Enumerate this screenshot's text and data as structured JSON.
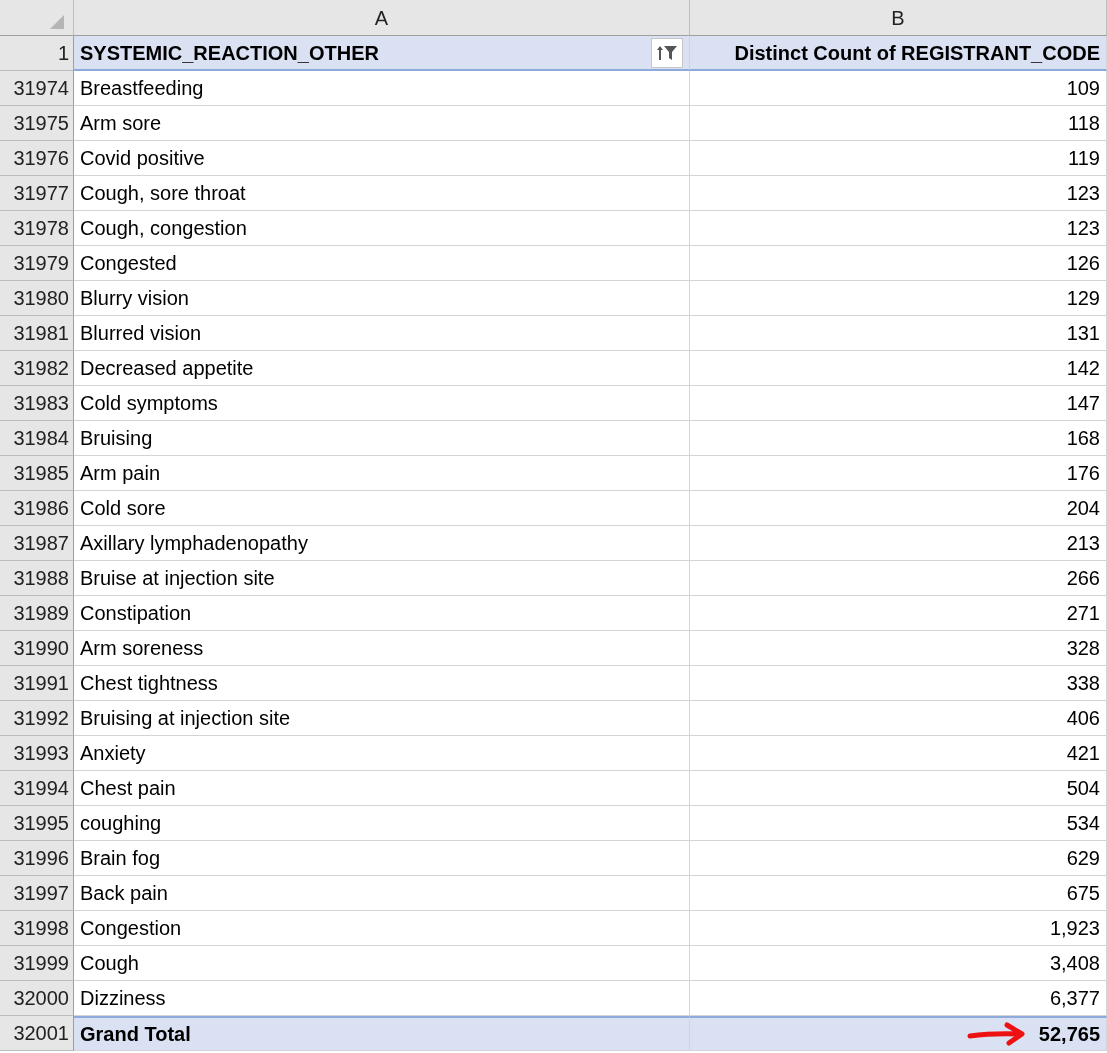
{
  "column_headers": [
    "A",
    "B"
  ],
  "header_row": {
    "row_number": "1",
    "column_1": "SYSTEMIC_REACTION_OTHER",
    "column_2": "Distinct Count of REGISTRANT_CODE",
    "filtered": true
  },
  "rows": [
    {
      "row_number": "31974",
      "label": "Breastfeeding",
      "count": "109"
    },
    {
      "row_number": "31975",
      "label": "Arm sore",
      "count": "118"
    },
    {
      "row_number": "31976",
      "label": "Covid positive",
      "count": "119"
    },
    {
      "row_number": "31977",
      "label": "Cough, sore throat",
      "count": "123"
    },
    {
      "row_number": "31978",
      "label": "Cough, congestion",
      "count": "123"
    },
    {
      "row_number": "31979",
      "label": "Congested",
      "count": "126"
    },
    {
      "row_number": "31980",
      "label": "Blurry vision",
      "count": "129"
    },
    {
      "row_number": "31981",
      "label": "Blurred vision",
      "count": "131"
    },
    {
      "row_number": "31982",
      "label": "Decreased appetite",
      "count": "142"
    },
    {
      "row_number": "31983",
      "label": "Cold symptoms",
      "count": "147"
    },
    {
      "row_number": "31984",
      "label": "Bruising",
      "count": "168"
    },
    {
      "row_number": "31985",
      "label": "Arm pain",
      "count": "176"
    },
    {
      "row_number": "31986",
      "label": "Cold sore",
      "count": "204"
    },
    {
      "row_number": "31987",
      "label": "Axillary lymphadenopathy",
      "count": "213"
    },
    {
      "row_number": "31988",
      "label": "Bruise at injection site",
      "count": "266"
    },
    {
      "row_number": "31989",
      "label": "Constipation",
      "count": "271"
    },
    {
      "row_number": "31990",
      "label": "Arm soreness",
      "count": "328"
    },
    {
      "row_number": "31991",
      "label": "Chest tightness",
      "count": "338"
    },
    {
      "row_number": "31992",
      "label": "Bruising at injection site",
      "count": "406"
    },
    {
      "row_number": "31993",
      "label": "Anxiety",
      "count": "421"
    },
    {
      "row_number": "31994",
      "label": "Chest pain",
      "count": "504"
    },
    {
      "row_number": "31995",
      "label": "coughing",
      "count": "534"
    },
    {
      "row_number": "31996",
      "label": "Brain fog",
      "count": "629"
    },
    {
      "row_number": "31997",
      "label": "Back pain",
      "count": "675"
    },
    {
      "row_number": "31998",
      "label": "Congestion",
      "count": "1,923"
    },
    {
      "row_number": "31999",
      "label": "Cough",
      "count": "3,408"
    },
    {
      "row_number": "32000",
      "label": "Dizziness",
      "count": "6,377"
    }
  ],
  "total_row": {
    "row_number": "32001",
    "label": "Grand Total",
    "count": "52,765",
    "annotated": true
  }
}
